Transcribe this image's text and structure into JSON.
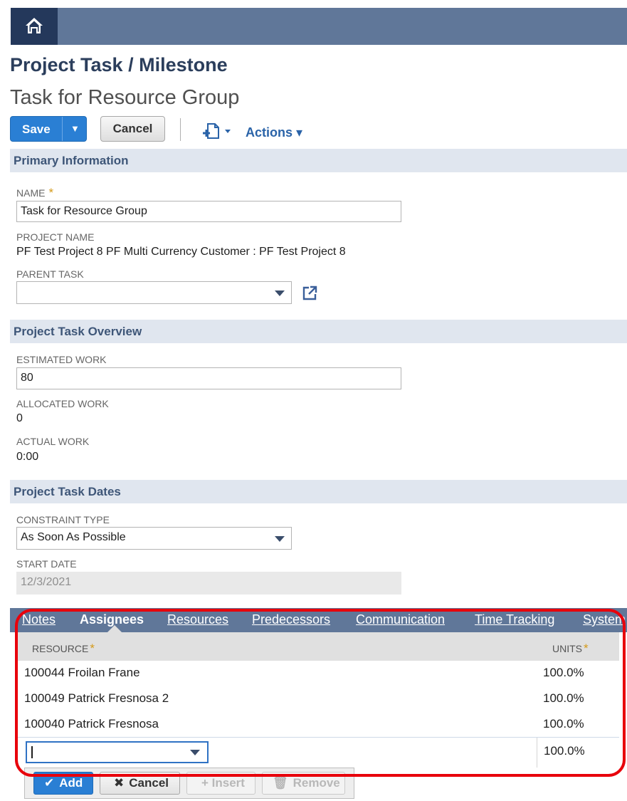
{
  "header": {
    "home_icon": "home-icon"
  },
  "page": {
    "title": "Project Task / Milestone",
    "record_name": "Task for Resource Group"
  },
  "toolbar": {
    "save_label": "Save",
    "save_menu_glyph": "▼",
    "cancel_label": "Cancel",
    "new_record_icon": "new-record-icon",
    "actions_label": "Actions ▾"
  },
  "sections": {
    "primary": "Primary Information",
    "overview": "Project Task Overview",
    "dates": "Project Task Dates"
  },
  "fields": {
    "name": {
      "label": "NAME",
      "required_mark": "*",
      "value": "Task for Resource Group"
    },
    "project_name": {
      "label": "PROJECT NAME",
      "value": "PF Test Project 8 PF Multi Currency Customer : PF Test Project 8"
    },
    "parent_task": {
      "label": "PARENT TASK",
      "value": ""
    },
    "estimated_work": {
      "label": "ESTIMATED WORK",
      "value": "80"
    },
    "allocated_work": {
      "label": "ALLOCATED WORK",
      "value": "0"
    },
    "actual_work": {
      "label": "ACTUAL WORK",
      "value": "0:00"
    },
    "constraint_type": {
      "label": "CONSTRAINT TYPE",
      "value": "As Soon As Possible"
    },
    "start_date": {
      "label": "START DATE",
      "value": "12/3/2021"
    }
  },
  "tabs": [
    "Notes",
    "Assignees",
    "Resources",
    "Predecessors",
    "Communication",
    "Time Tracking",
    "System"
  ],
  "active_tab": "Assignees",
  "grid": {
    "columns": {
      "resource": "RESOURCE",
      "units": "UNITS",
      "required_mark": "*"
    },
    "rows": [
      {
        "resource": "100044 Froilan Frane",
        "units": "100.0%"
      },
      {
        "resource": "100049 Patrick Fresnosa 2",
        "units": "100.0%"
      },
      {
        "resource": "100040 Patrick Fresnosa",
        "units": "100.0%"
      }
    ],
    "edit_row": {
      "resource": "",
      "units": "100.0%"
    },
    "buttons": {
      "add": "Add",
      "cancel": "Cancel",
      "insert": "+ Insert",
      "remove": "Remove"
    }
  },
  "colors": {
    "header_bar": "#607799",
    "primary_button": "#2a7fd4",
    "section_bg": "#e0e6ef",
    "highlight": "#e8000b"
  }
}
